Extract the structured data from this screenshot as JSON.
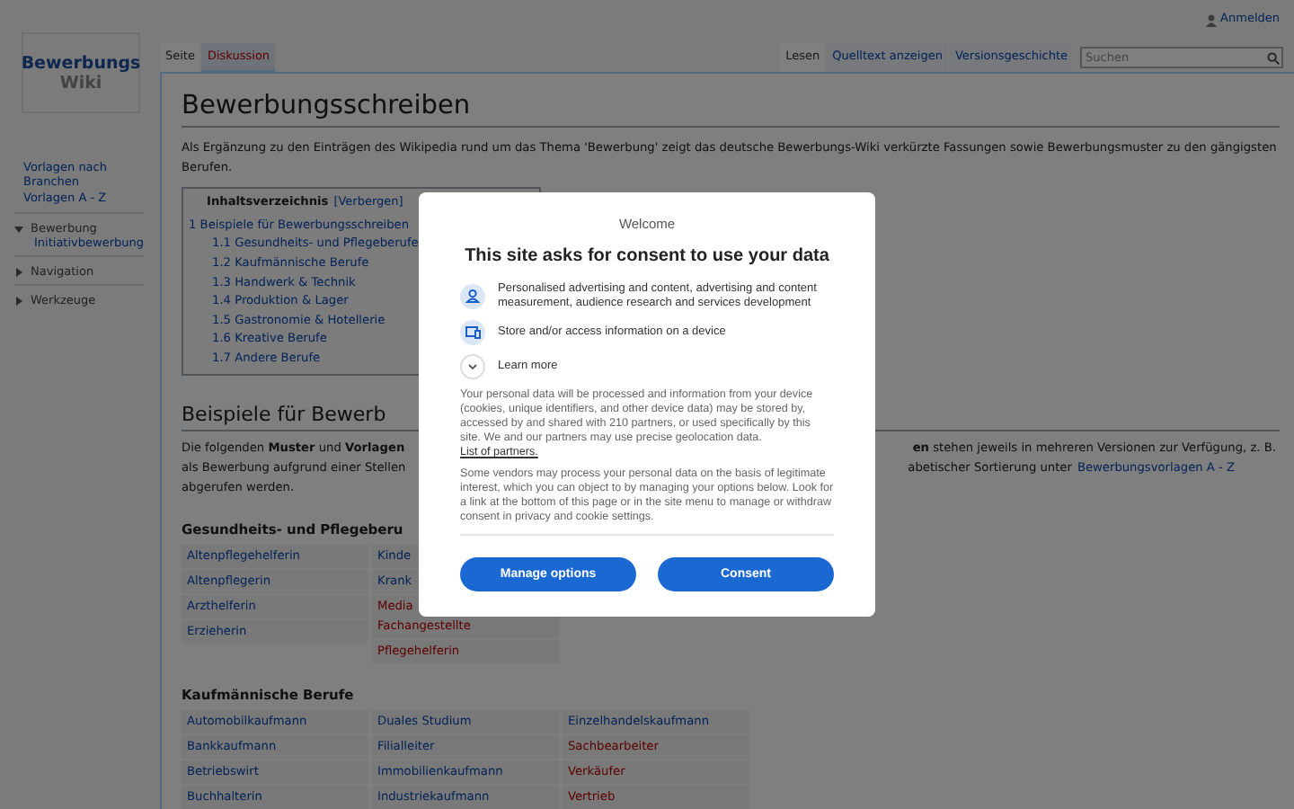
{
  "personal_tools": {
    "login": "Anmelden"
  },
  "logo": {
    "line_1": "Bewerbungs",
    "line_2": "Wiki"
  },
  "sidebar": {
    "links": [
      "Vorlagen nach Branchen",
      "Vorlagen A - Z"
    ],
    "portals": [
      {
        "label": "Bewerbung",
        "expanded": true,
        "children": [
          "Initiativbewerbung"
        ]
      },
      {
        "label": "Navigation",
        "expanded": false
      },
      {
        "label": "Werkzeuge",
        "expanded": false
      }
    ]
  },
  "page_tabs": [
    {
      "label": "Seite",
      "selected": true,
      "missing": false
    },
    {
      "label": "Diskussion",
      "selected": false,
      "missing": true
    }
  ],
  "view_tabs": [
    {
      "label": "Lesen",
      "selected": true
    },
    {
      "label": "Quelltext anzeigen",
      "selected": false
    },
    {
      "label": "Versionsgeschichte",
      "selected": false
    }
  ],
  "search": {
    "placeholder": "Suchen"
  },
  "title": "Bewerbungsschreiben",
  "intro": "Als Ergänzung zu den Einträgen des Wikipedia rund um das Thema 'Bewerbung' zeigt das deutsche Bewerbungs-Wiki verkürzte Fassungen sowie Bewerbungsmuster zu den gängigsten Berufen.",
  "toc": {
    "title": "Inhaltsverzeichnis",
    "toggle": "[Verbergen]",
    "items": [
      {
        "text": "1 Beispiele für Bewerbungsschreiben",
        "children": [
          {
            "text": "1.1 Gesundheits- und Pflegeberufe"
          },
          {
            "text": "1.2 Kaufmännische Berufe"
          },
          {
            "text": "1.3 Handwerk & Technik"
          },
          {
            "text": "1.4 Produktion & Lager"
          },
          {
            "text": "1.5 Gastronomie & Hotellerie"
          },
          {
            "text": "1.6 Kreative Berufe"
          },
          {
            "text": "1.7 Andere Berufe"
          }
        ]
      }
    ]
  },
  "section_heading": "Beispiele für Bewerb",
  "section_lines": [
    {
      "left": "Die folgenden **Muster** und **Vorlagen**",
      "right": "**en** stehen jeweils in mehreren Versionen zur Verfügung, z. B."
    },
    {
      "left": "als Bewerbung aufgrund einer Stellen",
      "right": "abetischer Sortierung unter",
      "link": "Bewerbungsvorlagen A - Z"
    },
    {
      "left": "abgerufen werden."
    }
  ],
  "groups": [
    {
      "heading": "Gesundheits- und Pflegeberu",
      "columns": [
        [
          {
            "lines": [
              "Altenpflegehelferin"
            ],
            "missing": false
          },
          {
            "lines": [
              "Altenpflegerin"
            ],
            "missing": false
          },
          {
            "lines": [
              "Arzthelferin"
            ],
            "missing": false
          },
          {
            "lines": [
              "Erzieherin"
            ],
            "missing": false
          }
        ],
        [
          {
            "lines": [
              "Kinde"
            ],
            "missing": false
          },
          {
            "lines": [
              "Krank"
            ],
            "missing": false
          },
          {
            "lines": [
              "Media",
              "Fachangestellte"
            ],
            "missing": true
          },
          {
            "lines": [
              "Pflegehelferin"
            ],
            "missing": true
          }
        ]
      ]
    },
    {
      "heading": "Kaufmännische Berufe",
      "columns": [
        [
          {
            "lines": [
              "Automobilkaufmann"
            ],
            "missing": false
          },
          {
            "lines": [
              "Bankkaufmann"
            ],
            "missing": false
          },
          {
            "lines": [
              "Betriebswirt"
            ],
            "missing": false
          },
          {
            "lines": [
              "Buchhalterin"
            ],
            "missing": false
          }
        ],
        [
          {
            "lines": [
              "Duales Studium"
            ],
            "missing": false
          },
          {
            "lines": [
              "Filialleiter"
            ],
            "missing": false
          },
          {
            "lines": [
              "Immobilienkaufmann"
            ],
            "missing": false
          },
          {
            "lines": [
              "Industriekaufmann"
            ],
            "missing": false
          }
        ],
        [
          {
            "lines": [
              "Einzelhandelskaufmann"
            ],
            "missing": false
          },
          {
            "lines": [
              "Sachbearbeiter"
            ],
            "missing": true
          },
          {
            "lines": [
              "Verkäufer"
            ],
            "missing": true
          },
          {
            "lines": [
              "Vertrieb"
            ],
            "missing": true
          }
        ]
      ]
    }
  ],
  "consent": {
    "welcome": "Welcome",
    "title": "This site asks for consent to use your data",
    "purposes": [
      {
        "kind": "person",
        "text": "Personalised advertising and content, advertising and content measurement, audience research and services development"
      },
      {
        "kind": "device",
        "text": "Store and/or access information on a device"
      }
    ],
    "learn_more": {
      "label": "Learn more",
      "expanded": false
    },
    "paragraph_1": "Your personal data will be processed and information from your device (cookies, unique identifiers, and other device data) may be stored by, accessed by and shared with 210 partners, or used specifically by this site. We and our partners may use precise geolocation data.",
    "partners_link": "List of partners.",
    "paragraph_2": "Some vendors may process your personal data on the basis of legitimate interest, which you can object to by managing your options below. Look for a link at the bottom of this page or in the site menu to manage or withdraw consent in privacy and cookie settings.",
    "buttons": [
      "Manage options",
      "Consent"
    ]
  }
}
